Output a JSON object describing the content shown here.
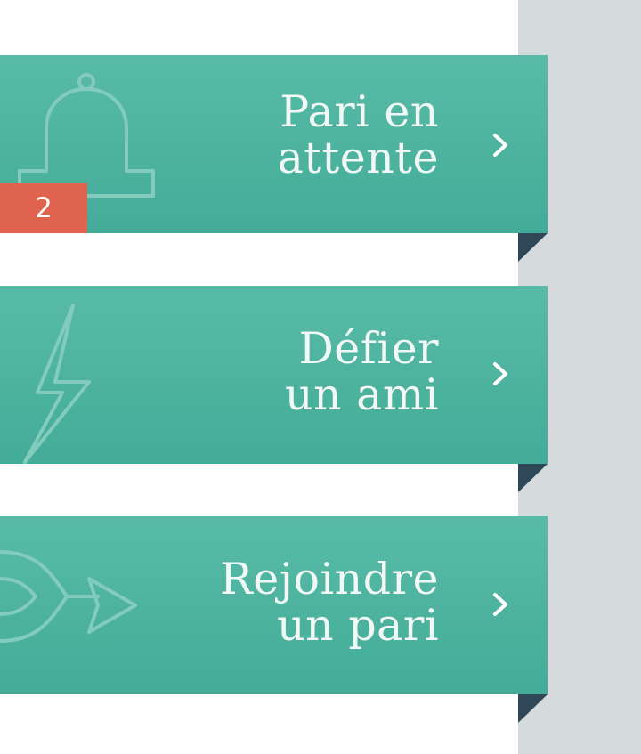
{
  "menu": {
    "pending_bets": {
      "line1": "Pari en",
      "line2": "attente",
      "badge": "2",
      "icon": "bell-icon"
    },
    "challenge_friend": {
      "line1": "Défier",
      "line2": "un ami",
      "icon": "lightning-icon"
    },
    "join_bet": {
      "line1": "Rejoindre",
      "line2": "un pari",
      "icon": "merge-arrows-icon"
    },
    "chevron_icon": "chevron-right-icon"
  },
  "colors": {
    "ribbon_top": "#58bba7",
    "ribbon_bottom": "#43ac98",
    "fold": "#2f4858",
    "badge": "#e0634f",
    "side_panel": "#d5dadd",
    "text": "#f1f8f6"
  }
}
